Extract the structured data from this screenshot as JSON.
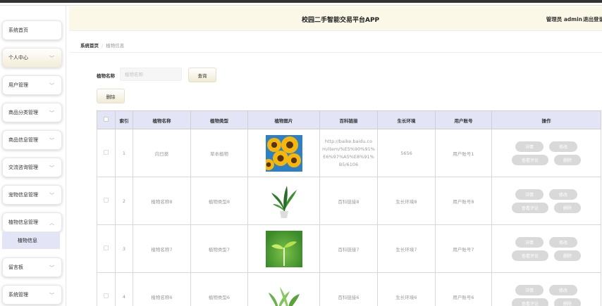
{
  "header": {
    "app_title": "校园二手智能交易平台APP",
    "admin_text": "管理员 admin",
    "logout": "退出登录"
  },
  "sidebar": {
    "items": [
      {
        "label": "系统首页",
        "chevron": false
      },
      {
        "label": "个人中心",
        "chevron": true
      },
      {
        "label": "用户管理",
        "chevron": true
      },
      {
        "label": "商品分类管理",
        "chevron": true
      },
      {
        "label": "商品信息管理",
        "chevron": true
      },
      {
        "label": "交流咨询管理",
        "chevron": true
      },
      {
        "label": "宠物信息管理",
        "chevron": true
      },
      {
        "label": "植物信息管理",
        "chevron": true,
        "expanded": true
      },
      {
        "label": "植物信息",
        "sub": true
      },
      {
        "label": "留言板",
        "chevron": true
      },
      {
        "label": "系统管理",
        "chevron": true
      }
    ],
    "chevron_down": "﹀",
    "chevron_up": "︿"
  },
  "breadcrumb": {
    "home": "系统首页",
    "separator": "/",
    "current": "植物信息"
  },
  "search": {
    "label": "植物名称",
    "placeholder": "植物名称",
    "button": "查询"
  },
  "actions": {
    "delete": "删除"
  },
  "table": {
    "headers": [
      "",
      "索引",
      "植物名称",
      "植物类型",
      "植物图片",
      "百科链接",
      "生长环境",
      "用户账号",
      "操作"
    ],
    "rows": [
      {
        "index": "1",
        "name": "向日葵",
        "type": "草本植物",
        "image": "sunflower",
        "link": "http://baike.baidu.com/item/%E5%90%91%E6%97%A5%E8%91%B5/6106",
        "env": "5656",
        "account": "用户账号1"
      },
      {
        "index": "2",
        "name": "植物名称8",
        "type": "植物类型8",
        "image": "potted-plant",
        "link": "百科链接8",
        "env": "生长环境8",
        "account": "用户账号8"
      },
      {
        "index": "3",
        "name": "植物名称7",
        "type": "植物类型7",
        "image": "sprout",
        "link": "百科链接7",
        "env": "生长环境7",
        "account": "用户账号7"
      },
      {
        "index": "4",
        "name": "植物名称6",
        "type": "植物类型6",
        "image": "seedlings",
        "link": "百科链接6",
        "env": "生长环境6",
        "account": "用户账号6"
      }
    ],
    "ops": {
      "detail": "详情",
      "edit": "修改",
      "comments": "查看评论",
      "delete": "删除"
    }
  }
}
